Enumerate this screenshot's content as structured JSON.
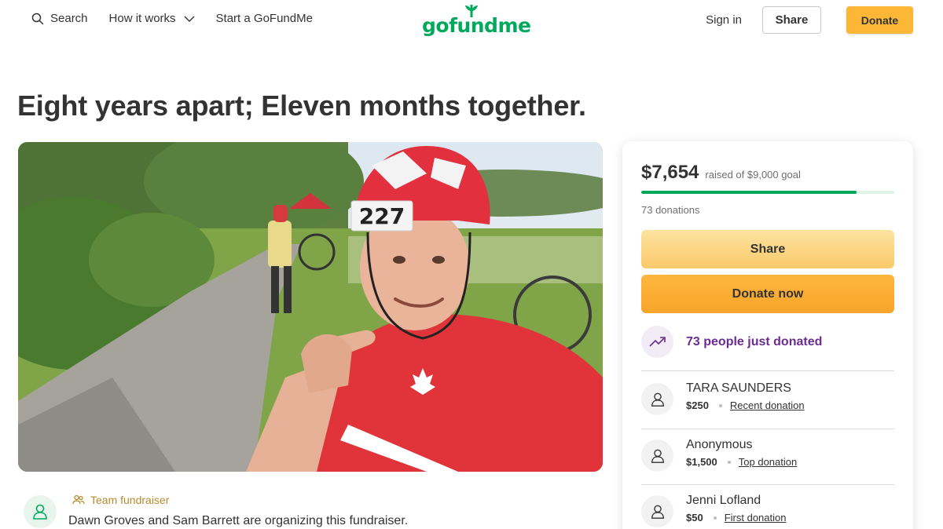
{
  "header": {
    "search_label": "Search",
    "how_it_works_label": "How it works",
    "start_label": "Start a GoFundMe",
    "logo_text": "gofundme",
    "signin_label": "Sign in",
    "share_label": "Share",
    "donate_label": "Donate"
  },
  "campaign": {
    "title": "Eight years apart; Eleven months together.",
    "hero_bib_number": "227",
    "team_label": "Team fundraiser",
    "organizer_text": "Dawn Groves and Sam Barrett are organizing this fundraiser."
  },
  "sidebar": {
    "raised_amount": "$7,654",
    "raised_goal_text": "raised of $9,000 goal",
    "progress_fraction": 0.85,
    "donations_count_text": "73 donations",
    "share_button": "Share",
    "donate_button": "Donate now",
    "trend_text": "73 people just donated",
    "donors": [
      {
        "name": "TARA SAUNDERS",
        "amount": "$250",
        "tag": "Recent donation"
      },
      {
        "name": "Anonymous",
        "amount": "$1,500",
        "tag": "Top donation"
      },
      {
        "name": "Jenni Lofland",
        "amount": "$50",
        "tag": "First donation"
      }
    ]
  },
  "colors": {
    "brand_green": "#02a95c",
    "donate_yellow": "#fbb735",
    "trend_purple": "#6b2c91"
  }
}
